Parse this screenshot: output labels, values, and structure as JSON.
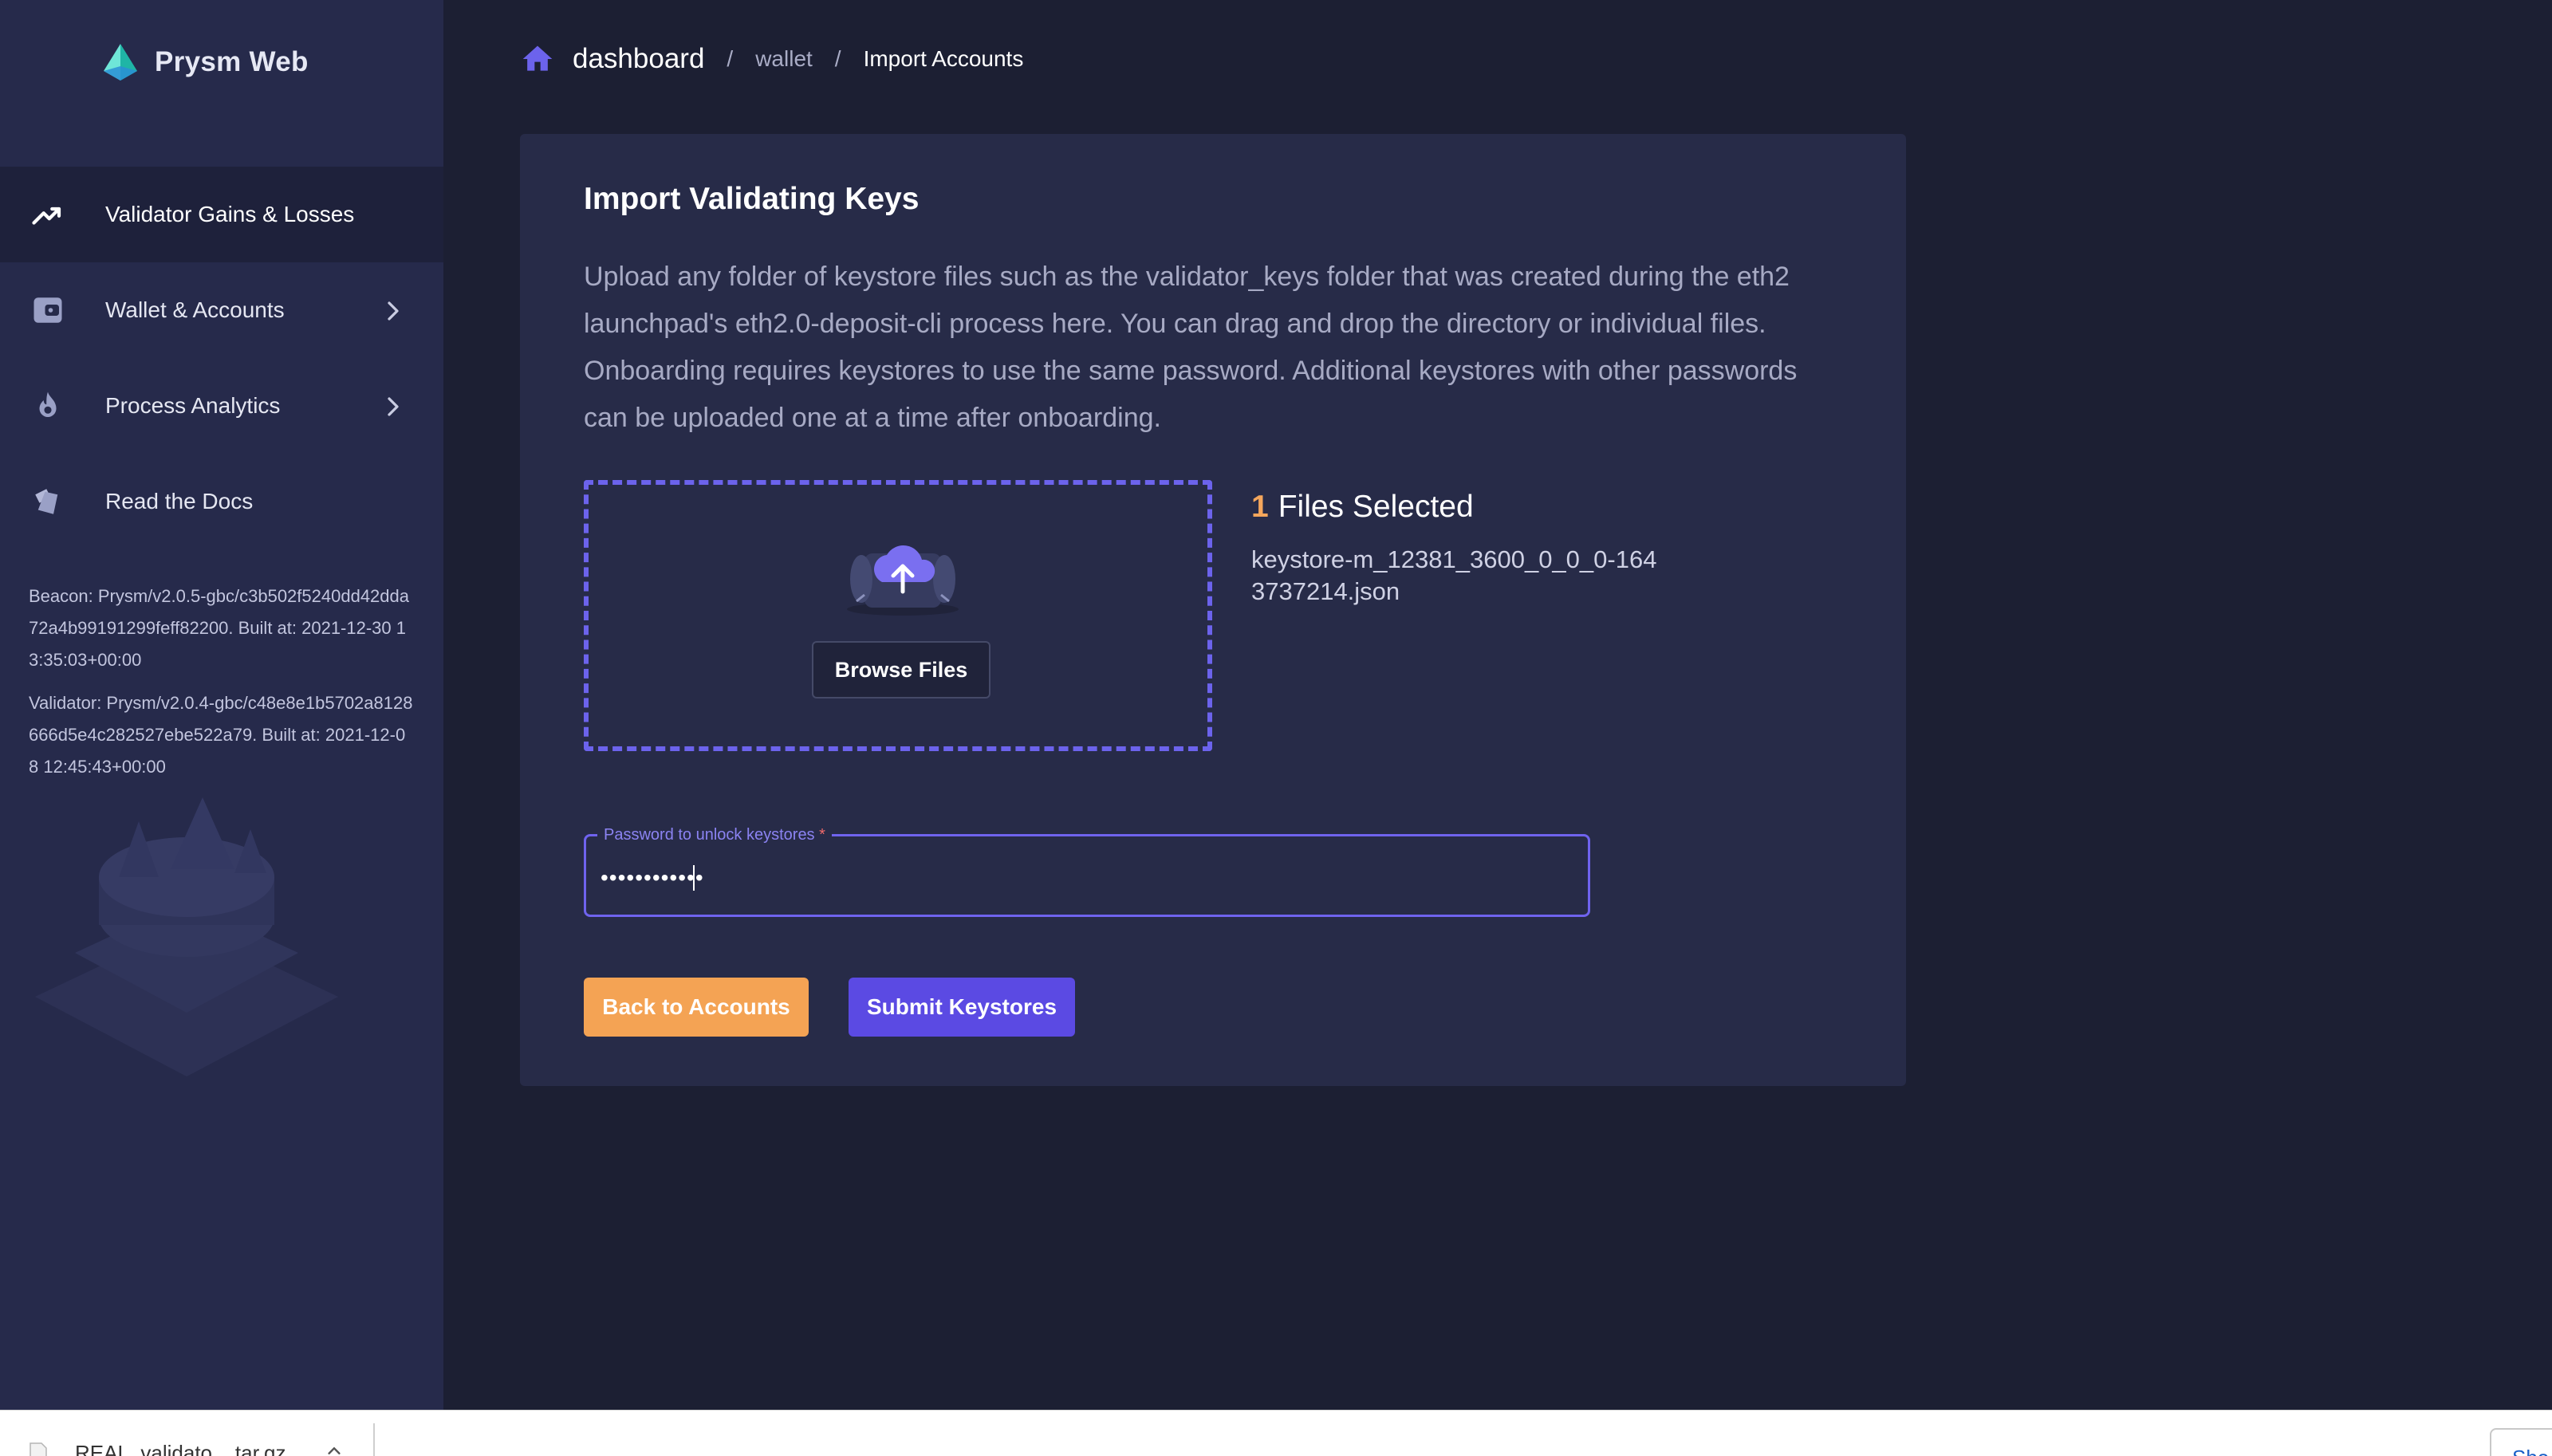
{
  "brand": {
    "name": "Prysm Web",
    "logo_icon": "prism-logo-icon"
  },
  "sidebar": {
    "items": [
      {
        "label": "Validator Gains & Losses",
        "icon": "trending-up-icon",
        "active": true,
        "has_chevron": false
      },
      {
        "label": "Wallet & Accounts",
        "icon": "wallet-icon",
        "active": false,
        "has_chevron": true
      },
      {
        "label": "Process Analytics",
        "icon": "flame-icon",
        "active": false,
        "has_chevron": true
      },
      {
        "label": "Read the Docs",
        "icon": "docs-icon",
        "active": false,
        "has_chevron": false
      }
    ],
    "beacon_version": "Beacon: Prysm/v2.0.5-gbc/c3b502f5240dd42dda72a4b99191299feff82200. Built at: 2021-12-30 13:35:03+00:00",
    "validator_version": "Validator: Prysm/v2.0.4-gbc/c48e8e1b5702a8128666d5e4c282527ebe522a79. Built at: 2021-12-08 12:45:43+00:00"
  },
  "breadcrumb": {
    "home_icon": "home-icon",
    "dashboard": "dashboard",
    "separator": "/",
    "wallet": "wallet",
    "current": "Import Accounts"
  },
  "import_card": {
    "title": "Import Validating Keys",
    "description": "Upload any folder of keystore files such as the validator_keys folder that was created during the eth2 launchpad's eth2.0-deposit-cli process here. You can drag and drop the directory or individual files. Onboarding requires keystores to use the same password. Additional keystores with other passwords can be uploaded one at a time after onboarding.",
    "upload_icon": "cloud-upload-icon",
    "browse_label": "Browse Files",
    "files_count": "1",
    "files_selected_label": "Files Selected",
    "file_name": "keystore-m_12381_3600_0_0_0-1643737214.json",
    "password_label": "Password to unlock keystores",
    "password_required_mark": "*",
    "password_value": "••••••••••••",
    "back_label": "Back to Accounts",
    "submit_label": "Submit Keystores"
  },
  "download_bar": {
    "file_name": "REAL_validato....tar.gz",
    "show_all_label": "Sho"
  },
  "colors": {
    "sidebar_bg": "#262a4b",
    "main_bg": "#1c1f33",
    "card_bg": "#272b48",
    "accent_purple": "#6c63ec",
    "accent_orange": "#f4a354",
    "submit_bg": "#5b4ae3"
  }
}
